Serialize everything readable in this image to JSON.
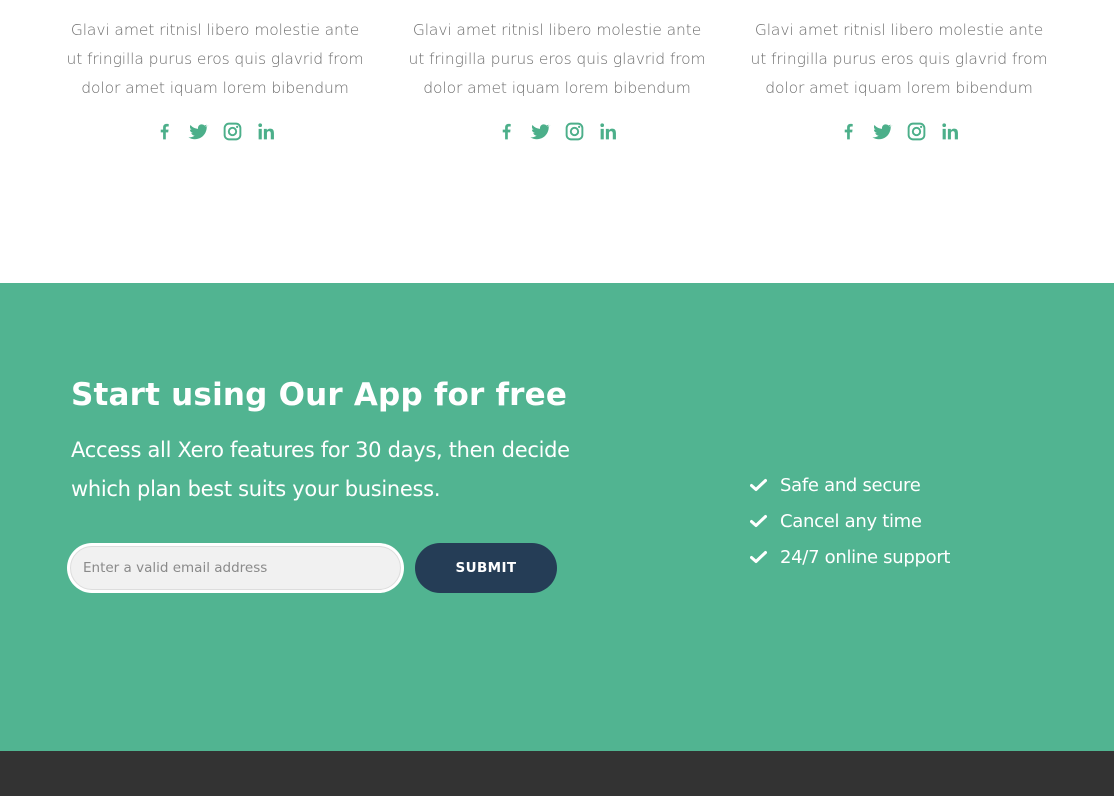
{
  "team": {
    "cards": [
      {
        "text_lines": [
          "Glavi amet ritnisl libero molestie ante",
          "ut fringilla purus eros quis glavrid from",
          "dolor amet iquam lorem bibendum"
        ],
        "socials": [
          "facebook-icon",
          "twitter-icon",
          "instagram-icon",
          "linkedin-icon"
        ]
      },
      {
        "text_lines": [
          "Glavi amet ritnisl libero molestie ante",
          "ut fringilla purus eros quis glavrid from",
          "dolor amet iquam lorem bibendum"
        ],
        "socials": [
          "facebook-icon",
          "twitter-icon",
          "instagram-icon",
          "linkedin-icon"
        ]
      },
      {
        "text_lines": [
          "Glavi amet ritnisl libero molestie ante",
          "ut fringilla purus eros quis glavrid from",
          "dolor amet iquam lorem bibendum"
        ],
        "socials": [
          "facebook-icon",
          "twitter-icon",
          "instagram-icon",
          "linkedin-icon"
        ]
      }
    ]
  },
  "cta": {
    "title": "Start using Our App for free",
    "subtitle_lines": [
      "Access all Xero features for 30 days, then decide",
      "which plan best suits your business."
    ],
    "email_placeholder": "Enter a valid email address",
    "submit_label": "SUBMIT",
    "features": [
      {
        "icon": "check-icon",
        "label": "Safe and secure"
      },
      {
        "icon": "check-icon",
        "label": "Cancel any time"
      },
      {
        "icon": "check-icon",
        "label": "24/7 online support"
      }
    ]
  },
  "colors": {
    "accent_green": "#51b491",
    "social_icon": "#4caf8a",
    "button_navy": "#253d56",
    "footer_dark": "#333333",
    "body_text": "#6d6d6d"
  }
}
